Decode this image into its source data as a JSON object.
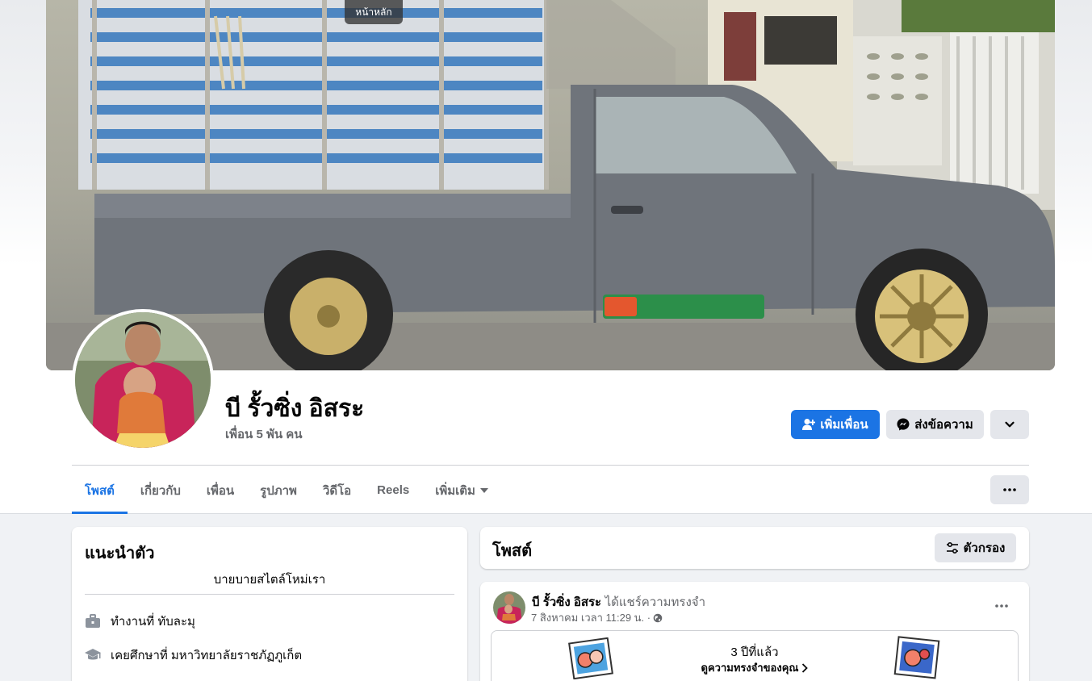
{
  "cover": {
    "tooltip": "หน้าหลัก"
  },
  "profile": {
    "name": "บี รั้วซิ่ง อิสระ",
    "friends": "เพื่อน 5 พัน คน"
  },
  "actions": {
    "add_friend": "เพิ่มเพื่อน",
    "message": "ส่งข้อความ"
  },
  "tabs": [
    {
      "label": "โพสต์",
      "active": true
    },
    {
      "label": "เกี่ยวกับ",
      "active": false
    },
    {
      "label": "เพื่อน",
      "active": false
    },
    {
      "label": "รูปภาพ",
      "active": false
    },
    {
      "label": "วิดีโอ",
      "active": false
    },
    {
      "label": "Reels",
      "active": false
    },
    {
      "label": "เพิ่มเติม",
      "active": false
    }
  ],
  "intro": {
    "title": "แนะนำตัว",
    "bio": "บายบายสไตล์โหม่เรา",
    "items": [
      {
        "icon": "briefcase-icon",
        "text": "ทำงานที่ ทับละมุ"
      },
      {
        "icon": "graduation-cap-icon",
        "text": "เคยศึกษาที่ มหาวิทยาลัยราชภัฏภูเก็ต"
      }
    ]
  },
  "posts_header": {
    "title": "โพสต์",
    "filter": "ตัวกรอง"
  },
  "post": {
    "author": "บี รั้วซิ่ง อิสระ",
    "action": "ได้แชร์ความทรงจำ",
    "time": "7 สิงหาคม เวลา 11:29 น. ·",
    "memory": {
      "title": "3 ปีที่แล้ว",
      "link": "ดูความทรงจำของคุณ"
    }
  },
  "colors": {
    "accent": "#1b74e4",
    "page_bg": "#f0f2f5",
    "secondary_text": "#65676b"
  }
}
